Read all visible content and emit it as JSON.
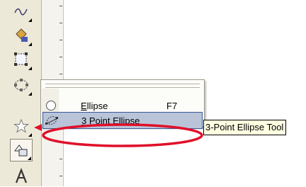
{
  "toolbox": {
    "tools": [
      {
        "name": "freehand-tool",
        "icon": "freehand-curve-icon"
      },
      {
        "name": "smart-fill-tool",
        "icon": "paint-bucket-icon"
      },
      {
        "name": "rectangle-tool",
        "icon": "rectangle-icon"
      },
      {
        "name": "ellipse-tool",
        "icon": "ellipse-icon"
      },
      {
        "name": "polygon-tool",
        "icon": "star-icon"
      },
      {
        "name": "basic-shapes-tool",
        "icon": "shapes-icon"
      },
      {
        "name": "text-tool",
        "icon": "text-a-icon"
      }
    ]
  },
  "flyout_menu": {
    "items": [
      {
        "label_underlined": "E",
        "label_rest": "llipse",
        "shortcut": "F7",
        "icon": "ellipse-outline-icon",
        "highlighted": false
      },
      {
        "label_underlined": "3",
        "label_rest": " Point Ellipse",
        "shortcut": "",
        "icon": "three-point-ellipse-icon",
        "highlighted": true
      }
    ]
  },
  "tooltip": {
    "text": "3-Point Ellipse Tool"
  },
  "colors": {
    "annotation": "#e0102a",
    "highlight": "#b9c4d9",
    "tooltip_bg": "#ffffe1"
  }
}
